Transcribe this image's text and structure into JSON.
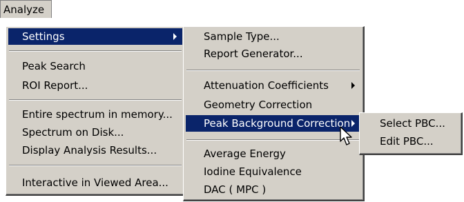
{
  "menubar": {
    "analyze_label": "Analyze"
  },
  "analyze_menu": {
    "items": [
      {
        "label": "Settings"
      },
      {
        "label": "Peak Search"
      },
      {
        "label": "ROI Report..."
      },
      {
        "label": "Entire spectrum in memory..."
      },
      {
        "label": "Spectrum on Disk..."
      },
      {
        "label": "Display Analysis Results..."
      },
      {
        "label": "Interactive in Viewed Area..."
      }
    ]
  },
  "settings_menu": {
    "items": [
      {
        "label": "Sample Type..."
      },
      {
        "label": "Report Generator..."
      },
      {
        "label": "Attenuation Coefficients"
      },
      {
        "label": "Geometry Correction"
      },
      {
        "label": "Peak Background Correction"
      },
      {
        "label": "Average Energy"
      },
      {
        "label": "Iodine Equivalence"
      },
      {
        "label": "DAC ( MPC )"
      }
    ]
  },
  "pbc_menu": {
    "items": [
      {
        "label": "Select PBC..."
      },
      {
        "label": "Edit PBC..."
      }
    ]
  },
  "colors": {
    "menu_bg": "#d4d0c8",
    "selection_bg": "#0a246a",
    "selection_text": "#ffffff"
  },
  "icons": {
    "submenu": "submenu-arrow-icon",
    "cursor": "mouse-pointer-icon"
  }
}
